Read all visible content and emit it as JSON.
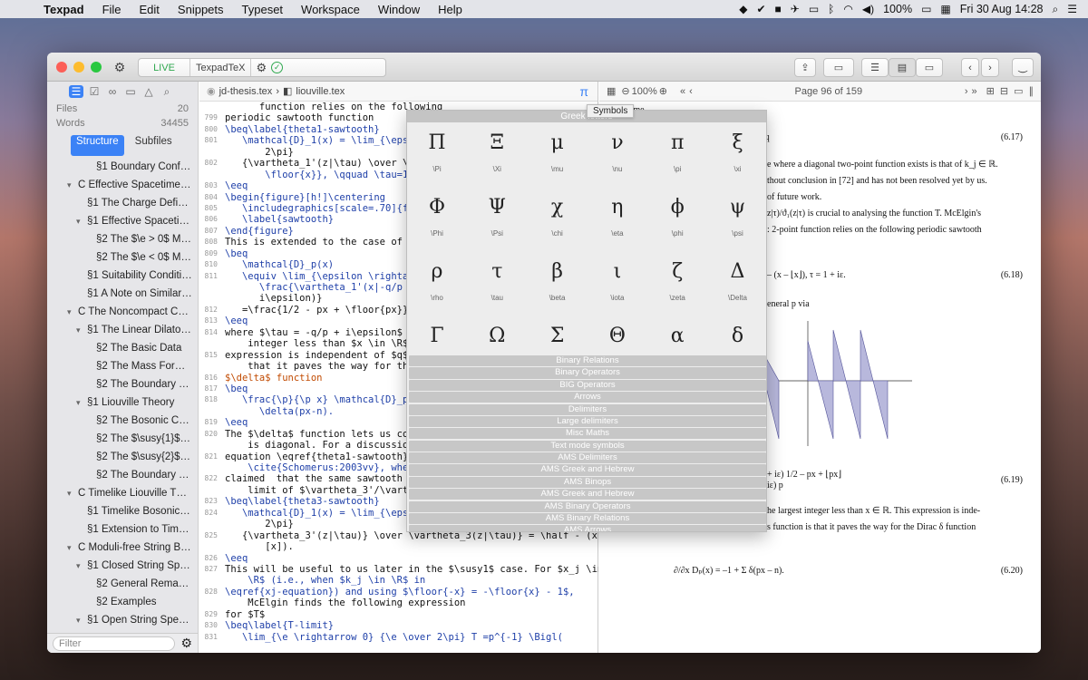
{
  "menubar": {
    "app": "Texpad",
    "items": [
      "File",
      "Edit",
      "Snippets",
      "Typeset",
      "Workspace",
      "Window",
      "Help"
    ],
    "battery": "100%",
    "datetime": "Fri 30 Aug  14:28"
  },
  "toolbar": {
    "live": "LIVE",
    "engine": "TexpadTeX"
  },
  "sidebar": {
    "files_label": "Files",
    "files_count": "20",
    "words_label": "Words",
    "words_count": "34455",
    "tab_structure": "Structure",
    "tab_subfiles": "Subfiles",
    "filter_placeholder": "Filter",
    "outline": [
      {
        "t": "§1 Boundary Conformal ...",
        "lvl": 2,
        "tw": ""
      },
      {
        "t": "C  Effective Spacetime Phy...",
        "lvl": 0,
        "tw": "v"
      },
      {
        "t": "§1 The Charge Deficit $\\e$",
        "lvl": 1,
        "tw": ""
      },
      {
        "t": "§1 Effective Spacetime P...",
        "lvl": 1,
        "tw": "v"
      },
      {
        "t": "§2 The $\\e > 0$ Models",
        "lvl": 2,
        "tw": ""
      },
      {
        "t": "§2 The $\\e < 0$ Models",
        "lvl": 2,
        "tw": ""
      },
      {
        "t": "§1 Suitability Conditions",
        "lvl": 1,
        "tw": ""
      },
      {
        "t": "§1 A Note on Similar App...",
        "lvl": 1,
        "tw": ""
      },
      {
        "t": "C  The Noncompact Confo...",
        "lvl": 0,
        "tw": "v"
      },
      {
        "t": "§1 The Linear Dilaton CFT",
        "lvl": 1,
        "tw": "v"
      },
      {
        "t": "§2 The Basic Data",
        "lvl": 2,
        "tw": ""
      },
      {
        "t": "§2 The Mass Formula",
        "lvl": 2,
        "tw": ""
      },
      {
        "t": "§2 The Boundary Theo...",
        "lvl": 2,
        "tw": ""
      },
      {
        "t": "§1 Liouville Theory",
        "lvl": 1,
        "tw": "v"
      },
      {
        "t": "§2 The Bosonic Case",
        "lvl": 2,
        "tw": ""
      },
      {
        "t": "§2 The $\\susy{1}$ Liou...",
        "lvl": 2,
        "tw": ""
      },
      {
        "t": "§2 The $\\susy{2}$ Lio...",
        "lvl": 2,
        "tw": ""
      },
      {
        "t": "§2 The Boundary Theo...",
        "lvl": 2,
        "tw": ""
      },
      {
        "t": "C  Timelike Liouville Theory",
        "lvl": 0,
        "tw": "v"
      },
      {
        "t": "§1 Timelike Bosonic Lio...",
        "lvl": 1,
        "tw": ""
      },
      {
        "t": "§1 Extension to Timelike ...",
        "lvl": 1,
        "tw": ""
      },
      {
        "t": "C  Moduli-free String Back...",
        "lvl": 0,
        "tw": "v"
      },
      {
        "t": "§1 Closed String Spectrum",
        "lvl": 1,
        "tw": "v"
      },
      {
        "t": "§2 General Remarks o...",
        "lvl": 2,
        "tw": ""
      },
      {
        "t": "§2 Examples",
        "lvl": 2,
        "tw": ""
      },
      {
        "t": "§1 Open String Spectrum",
        "lvl": 1,
        "tw": "v"
      }
    ]
  },
  "editor": {
    "crumb1": "jd-thesis.tex",
    "crumb2": "liouville.tex",
    "lines": [
      [
        "",
        "      function relies on the following"
      ],
      [
        "799",
        "periodic sawtooth function"
      ],
      [
        "800",
        "\\beq\\label{theta1-sawtooth}"
      ],
      [
        "801",
        "   \\mathcal{D}_1(x) = \\lim_{\\eps"
      ],
      [
        "",
        "       2\\pi}"
      ],
      [
        "802",
        "   {\\vartheta_1'(z|\\tau) \\over \\"
      ],
      [
        "",
        "       \\floor{x}}, \\qquad \\tau=1"
      ],
      [
        "803",
        "\\eeq"
      ],
      [
        "804",
        "\\begin{figure}[h!]\\centering"
      ],
      [
        "805",
        "   \\includegraphics[scale=.70]{f"
      ],
      [
        "806",
        "   \\label{sawtooth}"
      ],
      [
        "807",
        "\\end{figure}"
      ],
      [
        "808",
        "This is extended to the case of g"
      ],
      [
        "809",
        "\\beq"
      ],
      [
        "810",
        "   \\mathcal{D}_p(x)"
      ],
      [
        "811",
        "   \\equiv \\lim_{\\epsilon \\righta"
      ],
      [
        "",
        "      \\frac{\\vartheta_1'(x|-q/p"
      ],
      [
        "",
        "      i\\epsilon)}"
      ],
      [
        "812",
        "   =\\frac{1/2 - px + \\floor{px}}"
      ],
      [
        "813",
        "\\eeq"
      ],
      [
        "814",
        "where $\\tau = -q/p + i\\epsilon$ a"
      ],
      [
        "",
        "    integer less than $x \\in \\R$."
      ],
      [
        "815",
        "expression is independent of $q$."
      ],
      [
        "",
        "    that it paves the way for the"
      ],
      [
        "816",
        "$\\delta$ function"
      ],
      [
        "817",
        "\\beq"
      ],
      [
        "818",
        "   \\frac{\\p}{\\p x} \\mathcal{D}_p"
      ],
      [
        "",
        "      \\delta(px-n)."
      ],
      [
        "819",
        "\\eeq"
      ],
      [
        "820",
        "The $\\delta$ function lets us con"
      ],
      [
        "",
        "    is diagonal. For a discussion"
      ],
      [
        "821",
        "equation \\eqref{theta1-sawtooth},"
      ],
      [
        "",
        "    \\cite{Schomerus:2003vv}, wher"
      ],
      [
        "822",
        "claimed  that the same sawtooth f"
      ],
      [
        "",
        "    limit of $\\vartheta_3'/\\varthe"
      ],
      [
        "823",
        "\\beq\\label{theta3-sawtooth}"
      ],
      [
        "824",
        "   \\mathcal{D}_1(x) = \\lim_{\\eps"
      ],
      [
        "",
        "       2\\pi}"
      ],
      [
        "825",
        "   {\\vartheta_3'(z|\\tau)} \\over \\vartheta_3(z|\\tau)} = \\half - (x-"
      ],
      [
        "",
        "       [x])."
      ],
      [
        "826",
        "\\eeq"
      ],
      [
        "827",
        "This will be useful to us later in the $\\susy1$ case. For $x_j \\in"
      ],
      [
        "",
        "    \\R$ (i.e., when $k_j \\in \\R$ in"
      ],
      [
        "828",
        "\\eqref{xj-equation}) and using $\\floor{-x} = -\\floor{x} - 1$,"
      ],
      [
        "",
        "    McElgin finds the following expression"
      ],
      [
        "829",
        "for $T$"
      ],
      [
        "830",
        "\\beq\\label{T-limit}"
      ],
      [
        "831",
        "   \\lim_{\\e \\rightarrow 0} {\\e \\over 2\\pi} T =p^{-1} \\Bigl("
      ]
    ]
  },
  "pdf": {
    "zoom": "100%",
    "page": "Page 96 of 159",
    "texts": [
      [
        "in T become",
        0,
        4
      ],
      [
        "/q",
        180,
        34
      ],
      [
        "e where a diagonal two-point function exists is that of k_j ∈ ℝ.",
        185,
        64
      ],
      [
        "thout conclusion in [72] and has not been resolved yet by us.",
        185,
        82
      ],
      [
        " of future work.",
        185,
        100
      ],
      [
        "z|τ)/ϑ₁(z|τ) is crucial to analysing the function T. McElgin's",
        185,
        118
      ],
      [
        ": 2-point function relies on the following periodic sawtooth",
        185,
        136
      ],
      [
        "– (x – ⌊x⌋),          τ = 1 + iε.",
        185,
        186
      ],
      [
        "eneral p via",
        185,
        218
      ],
      [
        "+ iε)    1/2 – px + ⌊px⌋",
        185,
        406
      ],
      [
        "iε)                  p",
        185,
        418
      ],
      [
        "he largest integer less than x ∈ ℝ. This expression is inde-",
        185,
        446
      ],
      [
        "s function is that it paves the way for the Dirac δ function",
        185,
        464
      ],
      [
        "∂/∂x Dₚ(x) = –1 + Σ δ(px – n).",
        82,
        512
      ]
    ],
    "eqnums": [
      [
        "(6.17)",
        34
      ],
      [
        "(6.18)",
        186
      ],
      [
        "(6.19)",
        412
      ],
      [
        "(6.20)",
        512
      ]
    ]
  },
  "symbols": {
    "tooltip": "Symbols",
    "header": "Greek letters",
    "cells": [
      [
        "Π",
        "\\Pi"
      ],
      [
        "Ξ",
        "\\Xi"
      ],
      [
        "μ",
        "\\mu"
      ],
      [
        "ν",
        "\\nu"
      ],
      [
        "π",
        "\\pi"
      ],
      [
        "ξ",
        "\\xi"
      ],
      [
        "Φ",
        "\\Phi"
      ],
      [
        "Ψ",
        "\\Psi"
      ],
      [
        "χ",
        "\\chi"
      ],
      [
        "η",
        "\\eta"
      ],
      [
        "ϕ",
        "\\phi"
      ],
      [
        "ψ",
        "\\psi"
      ],
      [
        "ρ",
        "\\rho"
      ],
      [
        "τ",
        "\\tau"
      ],
      [
        "β",
        "\\beta"
      ],
      [
        "ι",
        "\\iota"
      ],
      [
        "ζ",
        "\\zeta"
      ],
      [
        "Δ",
        "\\Delta"
      ],
      [
        "Γ",
        ""
      ],
      [
        "Ω",
        ""
      ],
      [
        "Σ",
        ""
      ],
      [
        "Θ",
        ""
      ],
      [
        "α",
        ""
      ],
      [
        "δ",
        ""
      ]
    ],
    "categories": [
      "Binary Relations",
      "Binary Operators",
      "BIG Operators",
      "Arrows",
      "Delimiters",
      "Large delimiters",
      "Misc Maths",
      "Text mode symbols",
      "AMS Delimiters",
      "AMS Greek and Hebrew",
      "AMS Binops",
      "AMS Greek and Hebrew",
      "AMS Binary Operators",
      "AMS Binary Relations",
      "AMS Arrows"
    ]
  },
  "colors": {
    "accent": "#3b82f6",
    "live": "#2fa84f"
  }
}
